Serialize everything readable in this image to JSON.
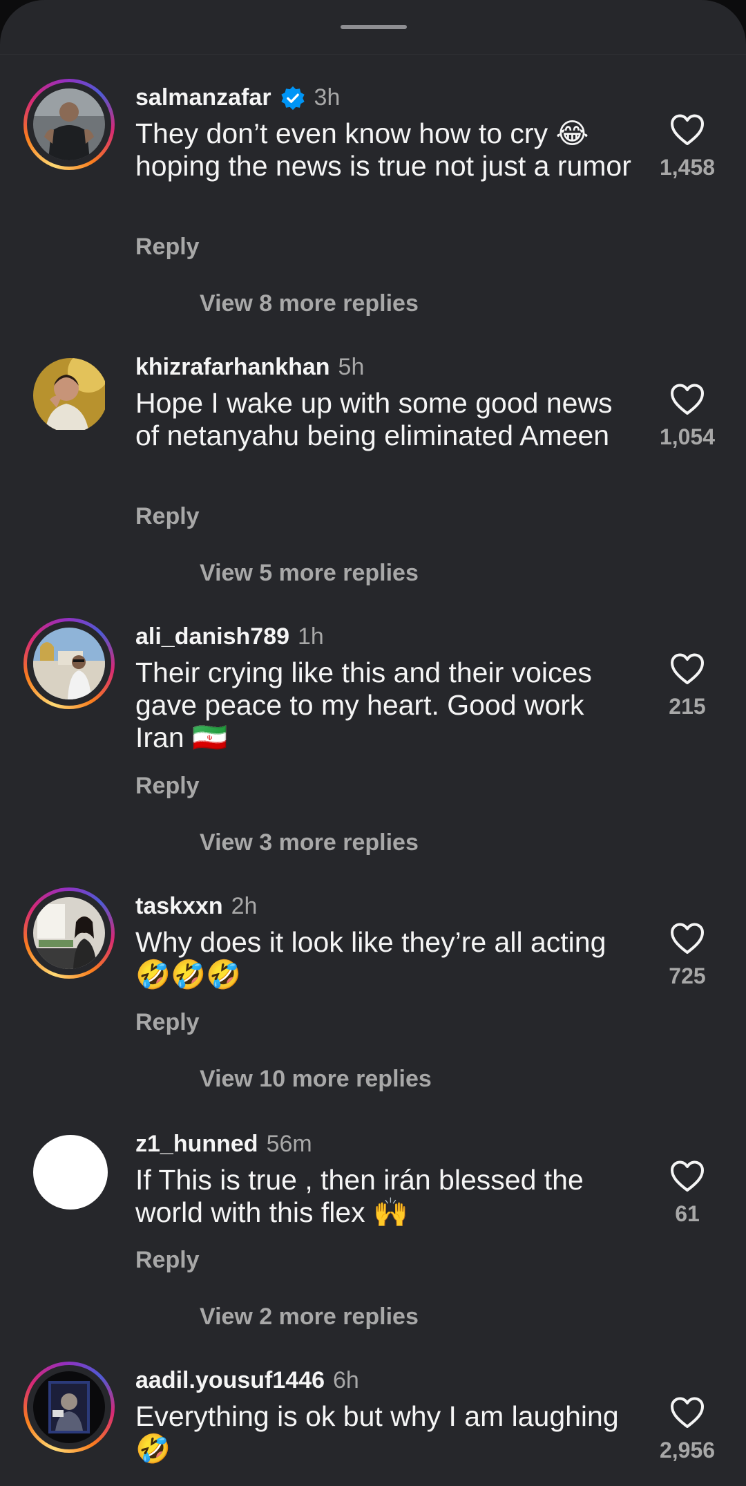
{
  "comments": [
    {
      "username": "salmanzafar",
      "verified": true,
      "time": "3h",
      "text": "They don’t even know how to cry 😂 hoping the news is true not just a rumor",
      "reply_label": "Reply",
      "likes": "1,458",
      "view_replies": "View 8 more replies"
    },
    {
      "username": "khizrafarhankhan",
      "verified": false,
      "time": "5h",
      "text": "Hope I wake up with some good news of netanyahu being eliminated Ameen",
      "reply_label": "Reply",
      "likes": "1,054",
      "view_replies": "View 5 more replies"
    },
    {
      "username": "ali_danish789",
      "verified": false,
      "time": "1h",
      "text": "Their crying like this and their voices gave peace to my heart. Good work Iran 🇮🇷",
      "reply_label": "Reply",
      "likes": "215",
      "view_replies": "View 3 more replies"
    },
    {
      "username": "taskxxn",
      "verified": false,
      "time": "2h",
      "text": "Why does it look like they’re all acting 🤣🤣🤣",
      "reply_label": "Reply",
      "likes": "725",
      "view_replies": "View 10 more replies"
    },
    {
      "username": "z1_hunned",
      "verified": false,
      "time": "56m",
      "text": "If This is true , then irán blessed the world with this flex 🙌",
      "reply_label": "Reply",
      "likes": "61",
      "view_replies": "View 2 more replies"
    },
    {
      "username": "aadil.yousuf1446",
      "verified": false,
      "time": "6h",
      "text": "Everything is ok but why I am laughing 🤣",
      "reply_label": "",
      "likes": "2,956",
      "view_replies": ""
    }
  ],
  "colors": {
    "sheet_bg": "#26272b",
    "text_primary": "#f5f5f5",
    "text_secondary": "#a8a8a8",
    "verified_blue": "#0095f6"
  },
  "icons": {
    "like": "heart-outline-icon",
    "verified": "verified-badge-icon"
  }
}
